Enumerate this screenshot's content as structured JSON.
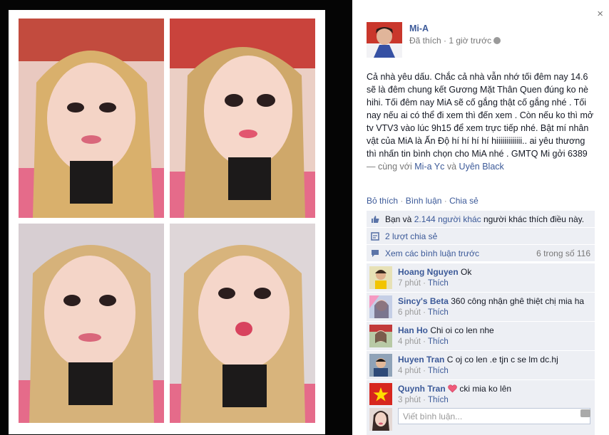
{
  "photo_collage": {
    "tile_count": 4
  },
  "close_glyph": "×",
  "post": {
    "author": "Mi-A",
    "meta": "Đã thích · 1 giờ trước",
    "body_text": "Cả nhà yêu dấu. Chắc cả nhà vẫn nhớ tối đêm nay 14.6 sẽ là đêm chung kết Gương Mặt Thân Quen đúng ko nè hihi. Tối đêm nay MiA sẽ cố gắng thật cố gắng nhé . Tối nay nếu ai có thể đi xem thì đến xem . Còn nếu ko thì mở tv VTV3 vào lúc 9h15 để xem trực tiếp nhé. Bật mí nhân vật của MiA là Ấn Độ hí hí hí hí hiiiiiiiiiiiii.. ai yêu thương thì nhấn tin bình chọn cho MiA nhé . GMTQ Mi gởi 6389",
    "with_prefix": " — cùng với ",
    "tagged_1": "Mi-a Yc",
    "and_word": " và ",
    "tagged_2": "Uyên Black"
  },
  "actions": {
    "like": "Bỏ thích",
    "sep": " · ",
    "comment": "Bình luận",
    "share": "Chia sẻ"
  },
  "ufi": {
    "likes_prefix": "Bạn và ",
    "likes_link": "2.144 người khác",
    "likes_suffix": " người khác thích điều này.",
    "shares": "2 lượt chia sẻ",
    "view_prev": "Xem các bình luận trước",
    "count": "6 trong số 116"
  },
  "comments": [
    {
      "name": "Hoang Nguyen",
      "text": "Ok",
      "time": "7 phút",
      "action": "Thích"
    },
    {
      "name": "Sincy's Beta",
      "text": "360 công nhận ghê thiệt chị mia ha",
      "time": "6 phút",
      "action": "Thích"
    },
    {
      "name": "Han Ho",
      "text": "Chi oi co len nhe",
      "time": "4 phút",
      "action": "Thích"
    },
    {
      "name": "Huyen Tran",
      "text": "C oj co len .e tjn c se lm dc.hj",
      "time": "4 phút",
      "action": "Thích"
    },
    {
      "name": "Quynh Tran",
      "text": "cki mia ko lên",
      "time": "3 phút",
      "action": "Thích"
    }
  ],
  "meta_sep": " · ",
  "composer": {
    "placeholder": "Viết bình luận..."
  },
  "colors": {
    "link": "#3b5998",
    "ufi_bg": "#edeff4",
    "photo_bg": "#050505"
  }
}
